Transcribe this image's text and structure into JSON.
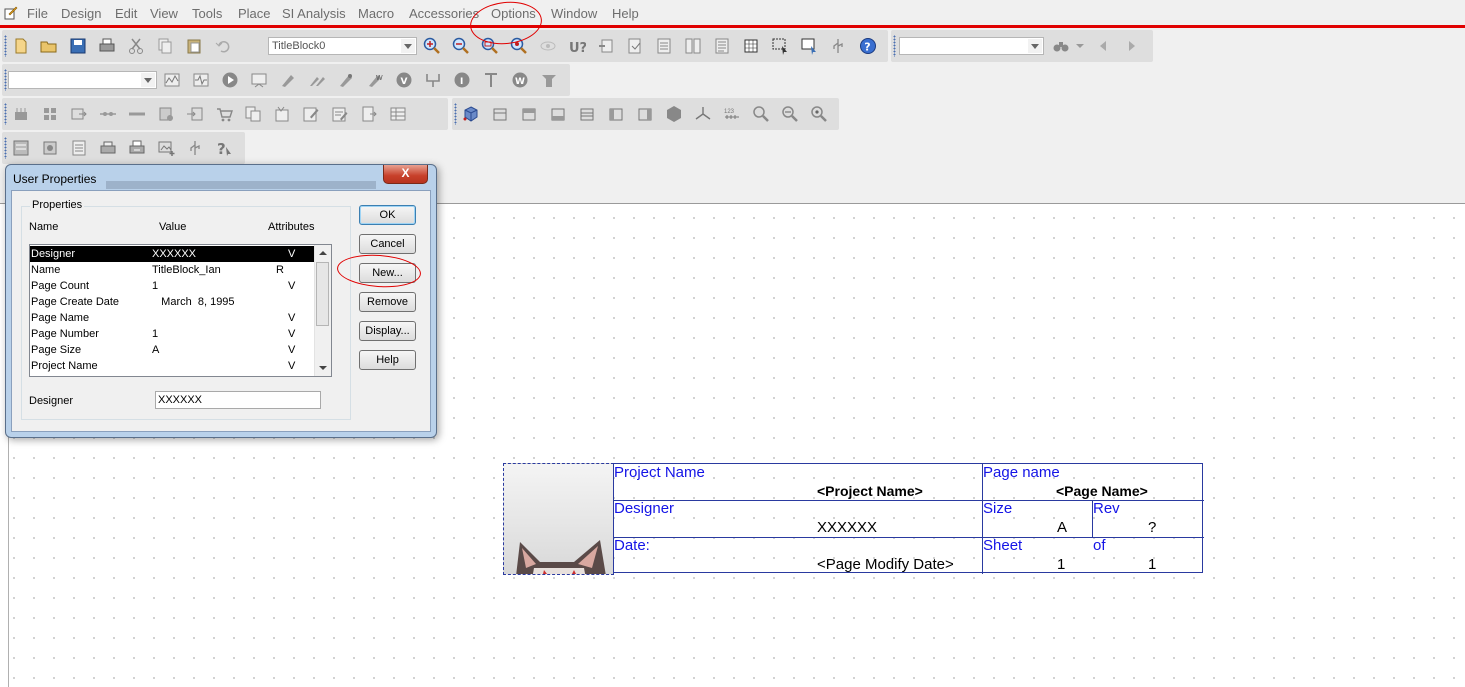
{
  "menu": [
    "File",
    "Design",
    "Edit",
    "View",
    "Tools",
    "Place",
    "SI Analysis",
    "Macro",
    "Accessories",
    "Options",
    "Window",
    "Help"
  ],
  "toolbar": {
    "block_combo": "TitleBlock0",
    "search_combo": "",
    "part_combo": ""
  },
  "dialog": {
    "title": "User Properties",
    "close_label": "X",
    "group_label": "Properties",
    "columns": [
      "Name",
      "Value",
      "Attributes"
    ],
    "rows": [
      {
        "name": "Designer",
        "value": "XXXXXX",
        "attr": "V",
        "selected": true
      },
      {
        "name": "Name",
        "value": "TitleBlock_Ian",
        "attr": "R",
        "selected": false
      },
      {
        "name": "Page Count",
        "value": "1",
        "attr": "V",
        "selected": false
      },
      {
        "name": "Page Create Date",
        "value": "   March  8, 1995",
        "attr": "",
        "selected": false
      },
      {
        "name": "Page Name",
        "value": "",
        "attr": "V",
        "selected": false
      },
      {
        "name": "Page Number",
        "value": "1",
        "attr": "V",
        "selected": false
      },
      {
        "name": "Page Size",
        "value": "A",
        "attr": "V",
        "selected": false
      },
      {
        "name": "Project Name",
        "value": "",
        "attr": "V",
        "selected": false
      }
    ],
    "field_label": "Designer",
    "field_value": "XXXXXX",
    "buttons": [
      "OK",
      "Cancel",
      "New...",
      "Remove",
      "Display...",
      "Help"
    ]
  },
  "title_block": {
    "project_name_label": "Project Name",
    "project_name_value": "<Project Name>",
    "page_name_label": "Page name",
    "page_name_value": "<Page Name>",
    "designer_label": "Designer",
    "designer_value": "XXXXXX",
    "size_label": "Size",
    "size_value": "A",
    "rev_label": "Rev",
    "rev_value": "?",
    "date_label": "Date:",
    "date_value": "<Page Modify Date>",
    "sheet_label": "Sheet",
    "sheet_value": "1",
    "of_label": "of",
    "of_value": "1"
  },
  "colors": {
    "annotation": "#e00000",
    "titleblock_label": "#1414e6",
    "titleblock_border": "#2a3aa0",
    "dialog_frame": "#b9d1ea"
  }
}
